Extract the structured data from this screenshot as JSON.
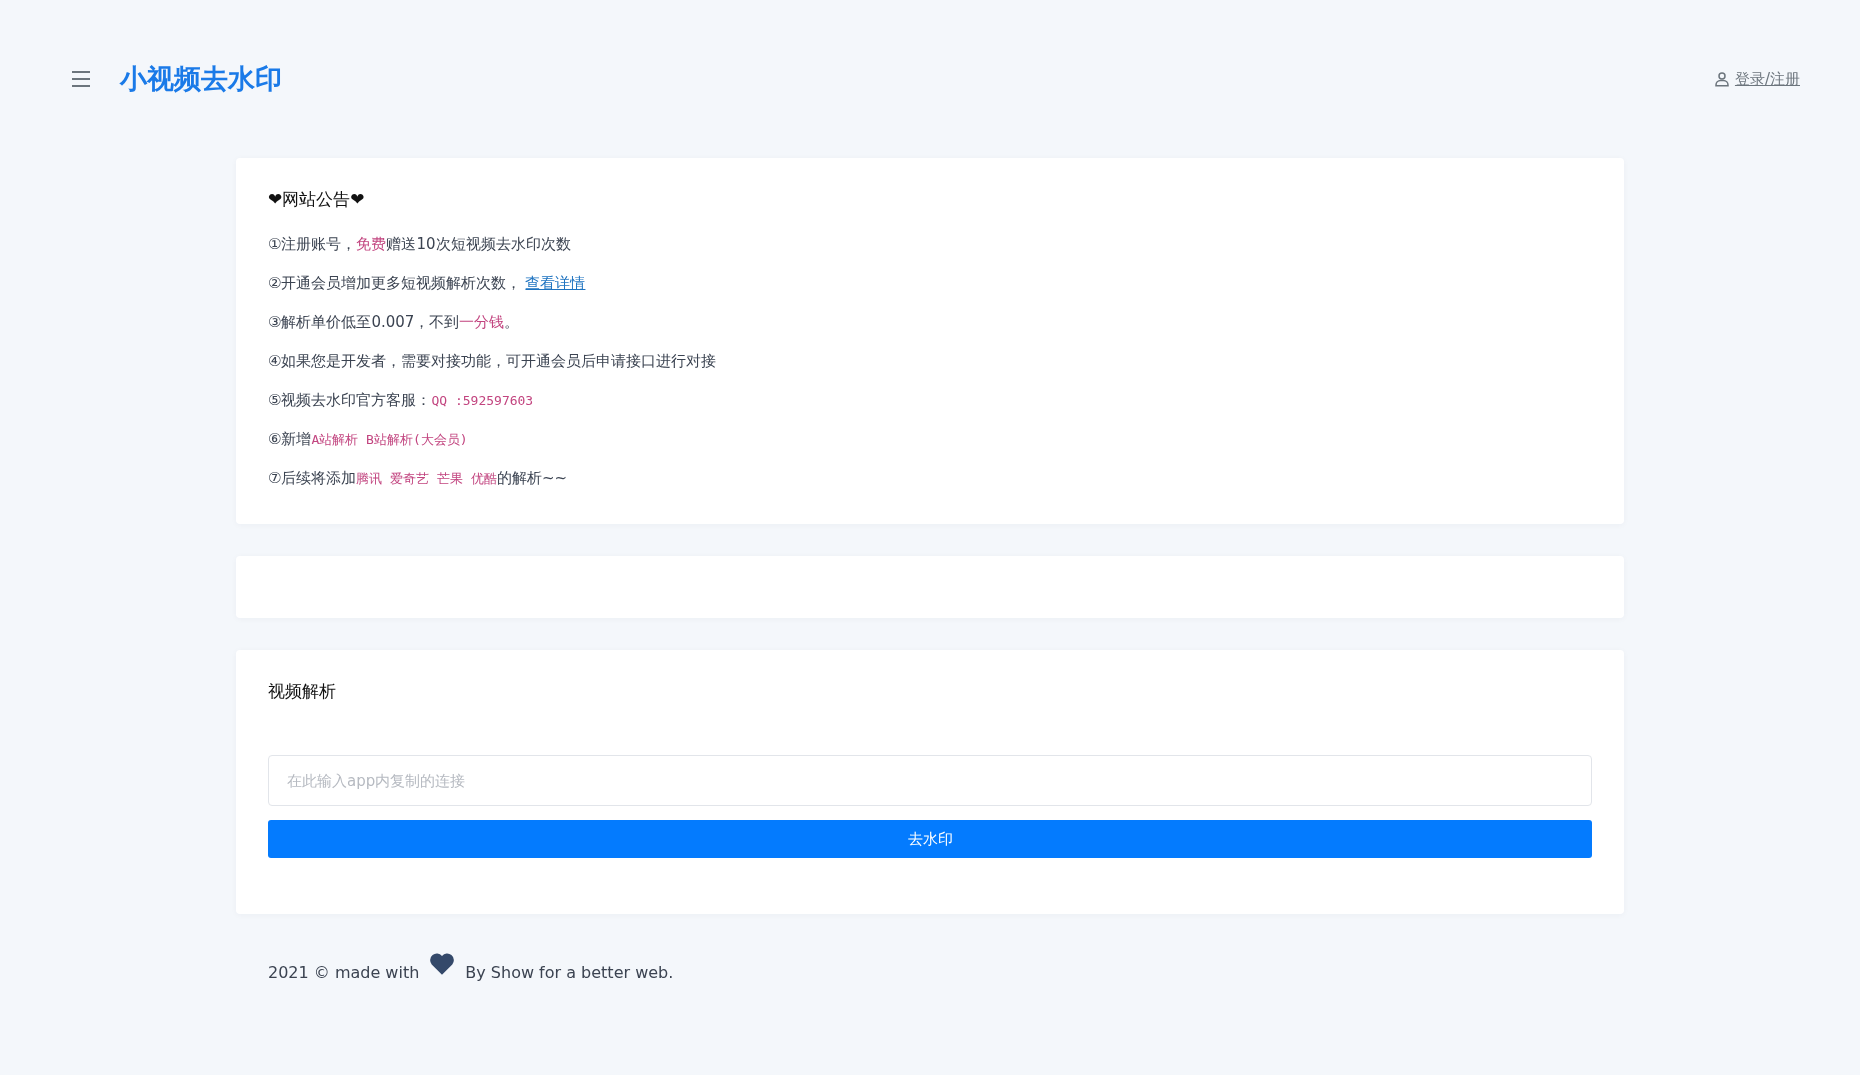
{
  "header": {
    "title": "小视频去水印",
    "login": "登录/注册"
  },
  "notice": {
    "title": "❤网站公告❤",
    "lines": [
      {
        "segments": [
          {
            "text": "①注册账号，",
            "kind": "plain"
          },
          {
            "text": "免费",
            "kind": "accent"
          },
          {
            "text": "赠送10次短视频去水印次数",
            "kind": "plain"
          }
        ]
      },
      {
        "segments": [
          {
            "text": "②开通会员增加更多短视频解析次数，",
            "kind": "plain"
          },
          {
            "text": "查看详情",
            "kind": "link"
          }
        ]
      },
      {
        "segments": [
          {
            "text": "③解析单价低至0.007，不到",
            "kind": "plain"
          },
          {
            "text": "一分钱",
            "kind": "accent"
          },
          {
            "text": "。",
            "kind": "plain"
          }
        ]
      },
      {
        "segments": [
          {
            "text": "④如果您是开发者，需要对接功能，可开通会员后申请接口进行对接",
            "kind": "plain"
          }
        ]
      },
      {
        "segments": [
          {
            "text": "⑤视频去水印官方客服：",
            "kind": "plain"
          },
          {
            "text": "QQ :592597603",
            "kind": "code"
          }
        ]
      },
      {
        "segments": [
          {
            "text": "⑥新增",
            "kind": "plain"
          },
          {
            "text": "A站解析 B站解析(大会员)",
            "kind": "code"
          }
        ]
      },
      {
        "segments": [
          {
            "text": "⑦后续将添加",
            "kind": "plain"
          },
          {
            "text": "腾讯 爱奇艺 芒果 优酷",
            "kind": "code"
          },
          {
            "text": "的解析~~",
            "kind": "plain"
          }
        ]
      }
    ]
  },
  "parser": {
    "title": "视频解析",
    "placeholder": "在此输入app内复制的连接",
    "button": "去水印"
  },
  "footer": {
    "before": "2021 © made with",
    "after": "By Show for a better web."
  }
}
